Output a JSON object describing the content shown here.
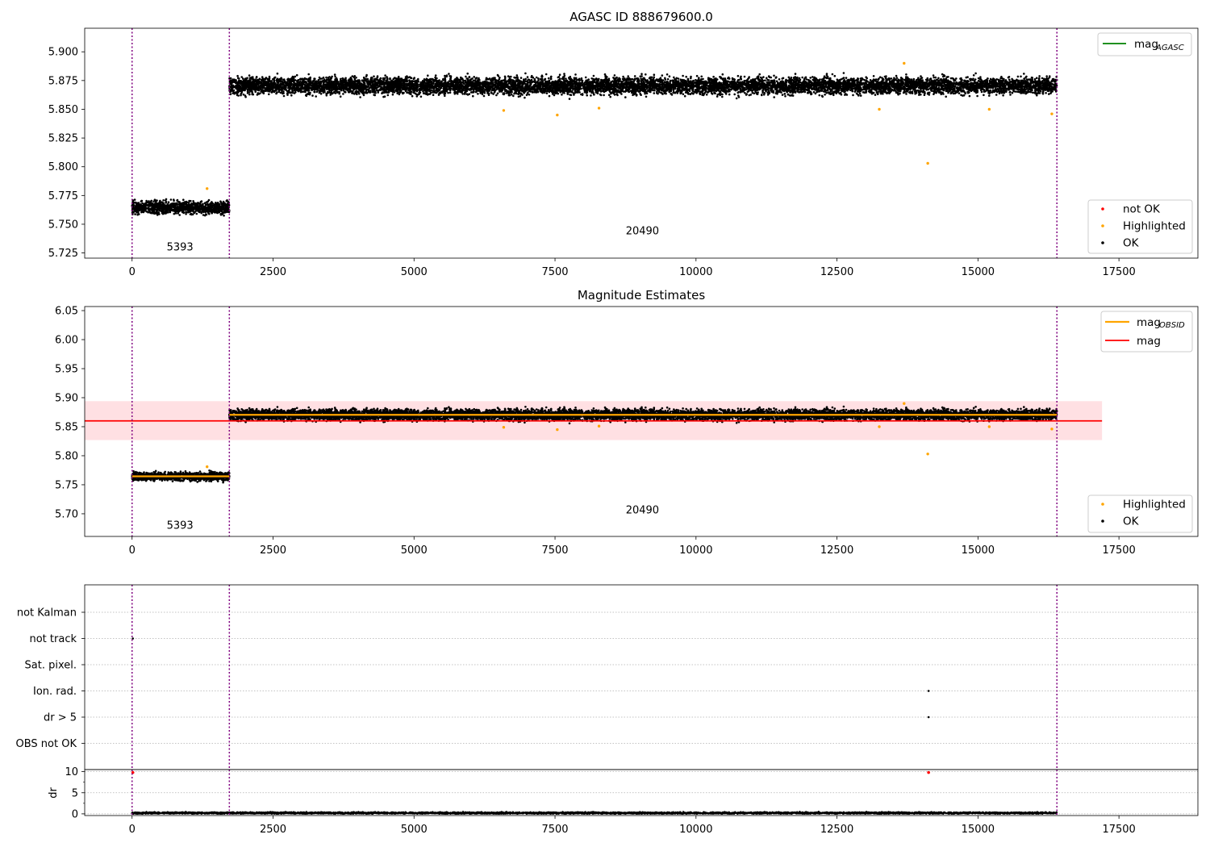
{
  "figure": {
    "vline_color": "#800080"
  },
  "chart_data": [
    {
      "type": "scatter",
      "title": "AGASC ID 888679600.0",
      "xlabel": "",
      "ylabel": "",
      "xlim": [
        -840,
        18900
      ],
      "ylim": [
        5.7205,
        5.9205
      ],
      "x_ticks": [
        0,
        2500,
        5000,
        7500,
        10000,
        12500,
        15000,
        17500
      ],
      "x_tick_labels": [
        "0",
        "2500",
        "5000",
        "7500",
        "10000",
        "12500",
        "15000",
        "17500"
      ],
      "y_ticks": [
        5.725,
        5.75,
        5.775,
        5.8,
        5.825,
        5.85,
        5.875,
        5.9
      ],
      "y_tick_labels": [
        "5.725",
        "5.750",
        "5.775",
        "5.800",
        "5.825",
        "5.850",
        "5.875",
        "5.900"
      ],
      "obsid_boundaries": [
        0,
        1725,
        16400
      ],
      "obsid_labels": [
        {
          "text": "5393",
          "x": 850,
          "y": 5.73
        },
        {
          "text": "20490",
          "x": 9050,
          "y": 5.744
        }
      ],
      "ok_bands": [
        {
          "x": [
            0,
            1725
          ],
          "mean": 5.7645,
          "spread": 0.0095
        },
        {
          "x": [
            1725,
            16400
          ],
          "mean": 5.8705,
          "spread": 0.0125
        }
      ],
      "highlighted_points": [
        {
          "x": 1330,
          "y": 5.781
        },
        {
          "x": 6590,
          "y": 5.849
        },
        {
          "x": 7540,
          "y": 5.845
        },
        {
          "x": 8280,
          "y": 5.851
        },
        {
          "x": 13250,
          "y": 5.85
        },
        {
          "x": 13690,
          "y": 5.89
        },
        {
          "x": 14110,
          "y": 5.803
        },
        {
          "x": 15200,
          "y": 5.85
        },
        {
          "x": 16310,
          "y": 5.846
        }
      ],
      "legend_upper": {
        "position": "top-right",
        "items": [
          {
            "label": "mag",
            "sub": "AGASC",
            "color": "#008000"
          }
        ]
      },
      "legend_lower": {
        "position": "bottom-right",
        "items": [
          {
            "label": "not OK",
            "color": "#ff0000"
          },
          {
            "label": "Highlighted",
            "color": "#ffa500"
          },
          {
            "label": "OK",
            "color": "#000000"
          }
        ]
      }
    },
    {
      "type": "scatter",
      "title": "Magnitude Estimates",
      "xlabel": "",
      "ylabel": "",
      "xlim": [
        -840,
        18900
      ],
      "ylim": [
        5.661,
        6.057
      ],
      "x_ticks": [
        0,
        2500,
        5000,
        7500,
        10000,
        12500,
        15000,
        17500
      ],
      "x_tick_labels": [
        "0",
        "2500",
        "5000",
        "7500",
        "10000",
        "12500",
        "15000",
        "17500"
      ],
      "y_ticks": [
        5.7,
        5.75,
        5.8,
        5.85,
        5.9,
        5.95,
        6.0,
        6.05
      ],
      "y_tick_labels": [
        "5.70",
        "5.75",
        "5.80",
        "5.85",
        "5.90",
        "5.95",
        "6.00",
        "6.05"
      ],
      "obsid_boundaries": [
        0,
        1725,
        16400
      ],
      "obsid_labels": [
        {
          "text": "5393",
          "x": 850,
          "y": 5.68
        },
        {
          "text": "20490",
          "x": 9050,
          "y": 5.706
        }
      ],
      "mag_line": {
        "value": 5.86,
        "x": [
          -840,
          17200
        ],
        "band": [
          5.827,
          5.894
        ],
        "color": "#ff0000",
        "band_color": "#ffe0e3"
      },
      "obsid_mag": [
        {
          "x": [
            0,
            1725
          ],
          "value": 5.7645
        },
        {
          "x": [
            1725,
            16400
          ],
          "value": 5.8705
        }
      ],
      "ok_bands": [
        {
          "x": [
            0,
            1725
          ],
          "mean": 5.7645,
          "spread": 0.012
        },
        {
          "x": [
            1725,
            16400
          ],
          "mean": 5.8705,
          "spread": 0.016
        }
      ],
      "highlighted_points": [
        {
          "x": 1330,
          "y": 5.781
        },
        {
          "x": 6590,
          "y": 5.849
        },
        {
          "x": 7540,
          "y": 5.845
        },
        {
          "x": 8280,
          "y": 5.851
        },
        {
          "x": 13250,
          "y": 5.85
        },
        {
          "x": 13690,
          "y": 5.89
        },
        {
          "x": 14110,
          "y": 5.803
        },
        {
          "x": 15200,
          "y": 5.85
        },
        {
          "x": 16310,
          "y": 5.846
        }
      ],
      "legend_upper": {
        "position": "top-right",
        "items": [
          {
            "label": "mag",
            "sub": "OBSID",
            "color": "#ffa500"
          },
          {
            "label": "mag",
            "sub": "",
            "color": "#ff0000"
          }
        ]
      },
      "legend_lower": {
        "position": "bottom-right",
        "items": [
          {
            "label": "Highlighted",
            "color": "#ffa500"
          },
          {
            "label": "OK",
            "color": "#000000"
          }
        ]
      }
    },
    {
      "type": "scatter",
      "title": "",
      "xlabel": "",
      "ylabel": "",
      "xlim": [
        -840,
        18900
      ],
      "categories": [
        "not Kalman",
        "not track",
        "Sat. pixel.",
        "Ion. rad.",
        "dr > 5",
        "OBS not OK"
      ],
      "flag_points": [
        {
          "category": "not track",
          "x": 0
        },
        {
          "category": "Ion. rad.",
          "x": 14110
        },
        {
          "category": "dr > 5",
          "x": 14110
        }
      ],
      "obsid_boundaries": [
        0,
        1725,
        16400
      ]
    },
    {
      "type": "scatter",
      "title": "",
      "xlabel": "",
      "ylabel": "dr",
      "xlim": [
        -840,
        18900
      ],
      "ylim": [
        -0.4,
        10.5
      ],
      "x_ticks": [
        0,
        2500,
        5000,
        7500,
        10000,
        12500,
        15000,
        17500
      ],
      "x_tick_labels": [
        "0",
        "2500",
        "5000",
        "7500",
        "10000",
        "12500",
        "15000",
        "17500"
      ],
      "y_ticks": [
        0,
        5,
        10
      ],
      "y_tick_labels": [
        "0",
        "5",
        "10"
      ],
      "obsid_boundaries": [
        0,
        1725,
        16400
      ],
      "dr_band": {
        "x": [
          0,
          16400
        ],
        "mean": 0.2,
        "spread": 0.35
      },
      "red_points": [
        {
          "x": 0,
          "y": 9.8
        },
        {
          "x": 14110,
          "y": 9.8
        }
      ]
    }
  ]
}
